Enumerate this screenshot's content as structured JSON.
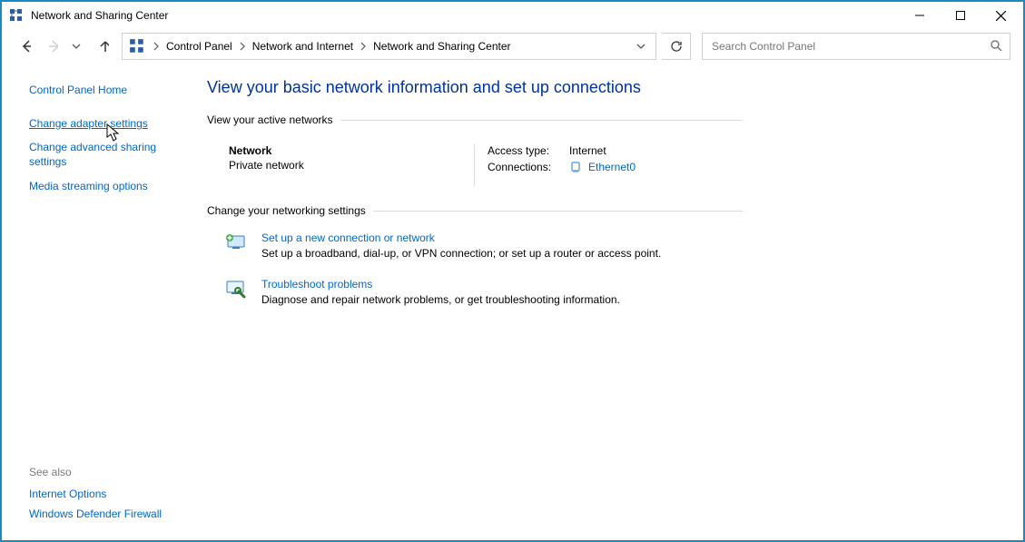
{
  "window": {
    "title": "Network and Sharing Center"
  },
  "breadcrumb": {
    "items": [
      "Control Panel",
      "Network and Internet",
      "Network and Sharing Center"
    ]
  },
  "search": {
    "placeholder": "Search Control Panel"
  },
  "sidebar": {
    "home": "Control Panel Home",
    "links": [
      {
        "label": "Change adapter settings"
      },
      {
        "label": "Change advanced sharing settings"
      },
      {
        "label": "Media streaming options"
      }
    ],
    "see_also_title": "See also",
    "see_also": [
      {
        "label": "Internet Options"
      },
      {
        "label": "Windows Defender Firewall"
      }
    ]
  },
  "main": {
    "heading": "View your basic network information and set up connections",
    "active_section": "View your active networks",
    "network": {
      "name": "Network",
      "type": "Private network",
      "access_label": "Access type:",
      "access_value": "Internet",
      "conn_label": "Connections:",
      "conn_value": "Ethernet0"
    },
    "settings_section": "Change your networking settings",
    "tasks": [
      {
        "title": "Set up a new connection or network",
        "desc": "Set up a broadband, dial-up, or VPN connection; or set up a router or access point."
      },
      {
        "title": "Troubleshoot problems",
        "desc": "Diagnose and repair network problems, or get troubleshooting information."
      }
    ]
  }
}
